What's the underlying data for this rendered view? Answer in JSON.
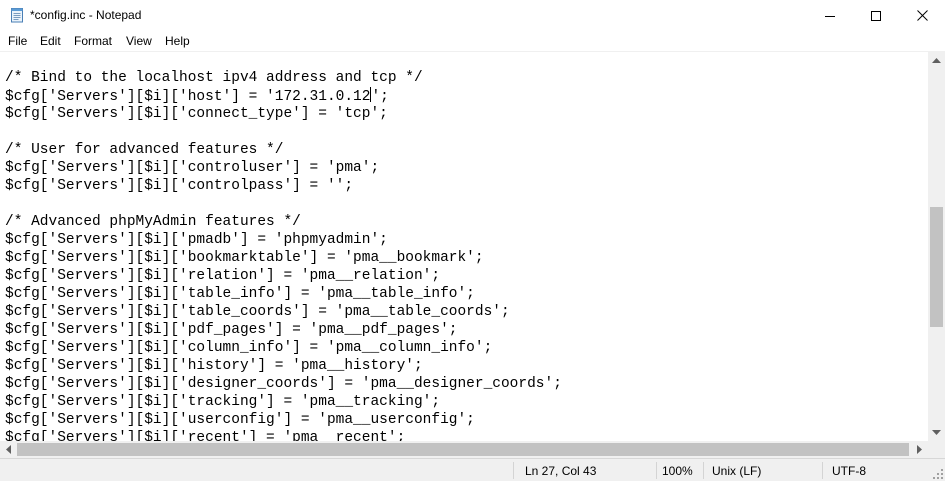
{
  "window": {
    "title": "*config.inc - Notepad",
    "icons": {
      "app": "notepad-icon",
      "minimize": "minimize-icon",
      "maximize": "maximize-icon",
      "close": "close-icon"
    }
  },
  "menu": {
    "items": [
      {
        "label": "File"
      },
      {
        "label": "Edit"
      },
      {
        "label": "Format"
      },
      {
        "label": "View"
      },
      {
        "label": "Help"
      }
    ]
  },
  "editor": {
    "cursor_line_index": 1,
    "lines": [
      "/* Bind to the localhost ipv4 address and tcp */",
      "$cfg['Servers'][$i]['host'] = '172.31.0.12';",
      "$cfg['Servers'][$i]['connect_type'] = 'tcp';",
      "",
      "/* User for advanced features */",
      "$cfg['Servers'][$i]['controluser'] = 'pma';",
      "$cfg['Servers'][$i]['controlpass'] = '';",
      "",
      "/* Advanced phpMyAdmin features */",
      "$cfg['Servers'][$i]['pmadb'] = 'phpmyadmin';",
      "$cfg['Servers'][$i]['bookmarktable'] = 'pma__bookmark';",
      "$cfg['Servers'][$i]['relation'] = 'pma__relation';",
      "$cfg['Servers'][$i]['table_info'] = 'pma__table_info';",
      "$cfg['Servers'][$i]['table_coords'] = 'pma__table_coords';",
      "$cfg['Servers'][$i]['pdf_pages'] = 'pma__pdf_pages';",
      "$cfg['Servers'][$i]['column_info'] = 'pma__column_info';",
      "$cfg['Servers'][$i]['history'] = 'pma__history';",
      "$cfg['Servers'][$i]['designer_coords'] = 'pma__designer_coords';",
      "$cfg['Servers'][$i]['tracking'] = 'pma__tracking';",
      "$cfg['Servers'][$i]['userconfig'] = 'pma__userconfig';",
      "$cfg['Servers'][$i]['recent'] = 'pma__recent';"
    ]
  },
  "status": {
    "position": "Ln 27, Col 43",
    "zoom": "100%",
    "line_ending": "Unix (LF)",
    "encoding": "UTF-8"
  }
}
